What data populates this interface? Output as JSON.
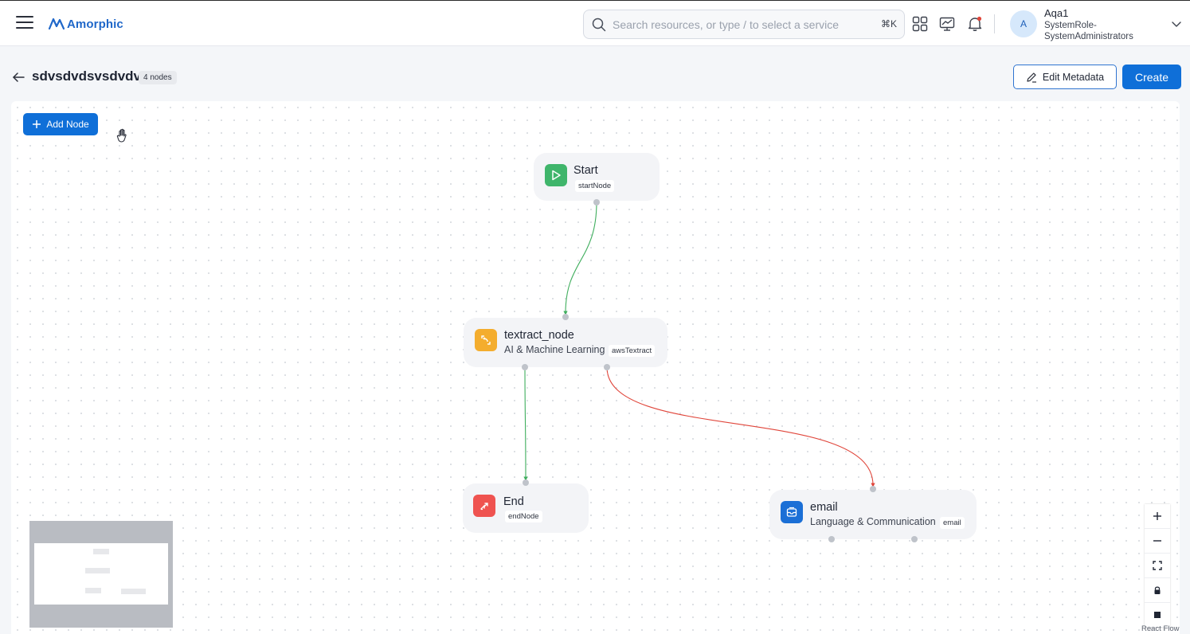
{
  "header": {
    "logo_text": "Amorphic",
    "search_placeholder": "Search resources, or type / to select a service",
    "search_shortcut": "⌘K",
    "icons": [
      "menu-icon",
      "grid-icon",
      "monitor-chart-icon",
      "bell-icon",
      "chevron-down-icon"
    ],
    "user": {
      "initial": "A",
      "name": "Aqa1",
      "role": "SystemRole-SystemAdministrators"
    }
  },
  "page": {
    "title": "sdvsdvdsvsdvdv",
    "nodes_badge": "4 nodes",
    "edit_metadata_label": "Edit Metadata",
    "create_label": "Create"
  },
  "canvas": {
    "add_node_label": "Add Node",
    "nodes": {
      "start": {
        "title": "Start",
        "tag": "startNode",
        "color": "#3fb56b"
      },
      "textract": {
        "title": "textract_node",
        "subtitle": "AI & Machine Learning",
        "tag": "awsTextract",
        "color": "#f4ad2e"
      },
      "end": {
        "title": "End",
        "tag": "endNode",
        "color": "#ef5350"
      },
      "email": {
        "title": "email",
        "subtitle": "Language & Communication",
        "tag": "email",
        "color": "#1b6fd6"
      }
    },
    "edges": [
      {
        "from": "start",
        "to": "textract",
        "status": "success",
        "color": "#3fae5d"
      },
      {
        "from": "textract",
        "to": "end",
        "status": "success",
        "color": "#3fae5d"
      },
      {
        "from": "textract",
        "to": "email",
        "status": "failure",
        "color": "#e0453a"
      }
    ],
    "attribution": "React Flow"
  }
}
